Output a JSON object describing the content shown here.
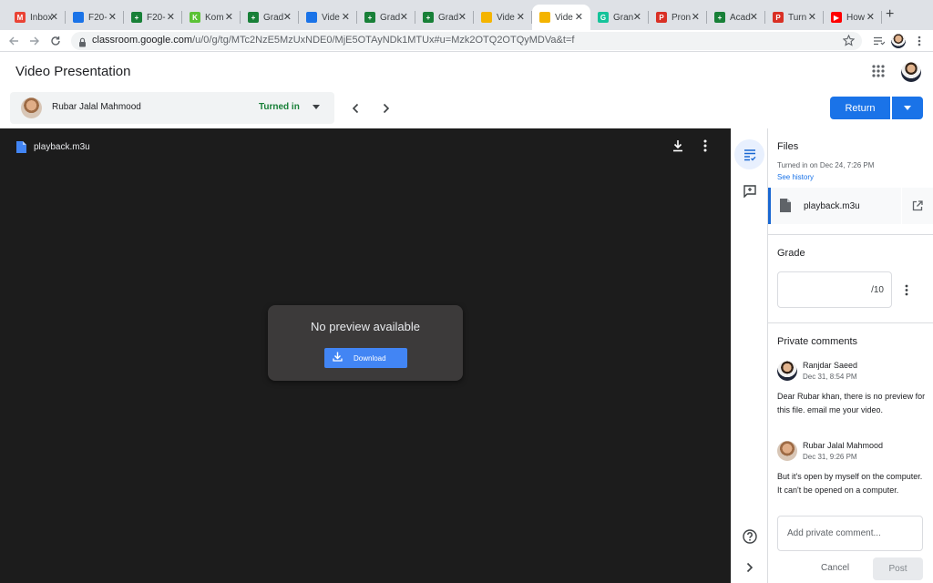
{
  "browser": {
    "tabs": [
      {
        "label": "Inbox",
        "favicon": "gmail-icon",
        "color": "#ea4335",
        "glyph": "M"
      },
      {
        "label": "F20-",
        "favicon": "classroom-icon",
        "color": "#1a73e8",
        "glyph": ""
      },
      {
        "label": "F20-",
        "favicon": "sheets-icon",
        "color": "#188038",
        "glyph": "+"
      },
      {
        "label": "Kom",
        "favicon": "kahoot-icon",
        "color": "#5bc236",
        "glyph": "K"
      },
      {
        "label": "Grad",
        "favicon": "sheets-icon",
        "color": "#188038",
        "glyph": "+"
      },
      {
        "label": "Vide",
        "favicon": "classroom-icon",
        "color": "#1a73e8",
        "glyph": ""
      },
      {
        "label": "Grad",
        "favicon": "sheets-icon",
        "color": "#188038",
        "glyph": "+"
      },
      {
        "label": "Grad",
        "favicon": "sheets-icon",
        "color": "#188038",
        "glyph": "+"
      },
      {
        "label": "Vide",
        "favicon": "slides-icon",
        "color": "#f4b400",
        "glyph": ""
      },
      {
        "label": "Vide",
        "favicon": "classroom-icon",
        "color": "#f4b400",
        "glyph": "",
        "active": true
      },
      {
        "label": "Gran",
        "favicon": "grammarly-icon",
        "color": "#15c39a",
        "glyph": "G"
      },
      {
        "label": "Pron",
        "favicon": "pronunciation-icon",
        "color": "#d93025",
        "glyph": "Ρ"
      },
      {
        "label": "Acad",
        "favicon": "sheets-icon",
        "color": "#188038",
        "glyph": "+"
      },
      {
        "label": "Turn",
        "favicon": "turnitin-icon",
        "color": "#d93025",
        "glyph": "Ρ"
      },
      {
        "label": "How",
        "favicon": "youtube-icon",
        "color": "#ff0000",
        "glyph": "▶"
      }
    ],
    "url_host": "classroom.google.com",
    "url_path": "/u/0/g/tg/MTc2NzE5MzUxNDE0/MjE5OTAyNDk1MTUx#u=Mzk2OTQ2OTQyMDVa&t=f"
  },
  "app": {
    "title": "Video Presentation",
    "student": {
      "name": "Rubar Jalal Mahmood",
      "status": "Turned in"
    },
    "return_label": "Return"
  },
  "viewer": {
    "file_name": "playback.m3u",
    "no_preview": "No preview available",
    "download_label": "Download"
  },
  "panel": {
    "files_title": "Files",
    "turned_in": "Turned in on Dec 24, 7:26 PM",
    "see_history": "See history",
    "attachment": "playback.m3u",
    "grade_title": "Grade",
    "grade_denominator": "/10",
    "comments_title": "Private comments",
    "comments": [
      {
        "author": "Ranjdar Saeed",
        "date": "Dec 31, 8:54 PM",
        "text": "Dear Rubar khan, there is no preview for this file. email me your video."
      },
      {
        "author": "Rubar Jalal Mahmood",
        "date": "Dec 31, 9:26 PM",
        "text": "But it's open by myself on the computer. It can't be opened on a computer."
      }
    ],
    "comment_placeholder": "Add private comment...",
    "cancel_label": "Cancel",
    "post_label": "Post"
  },
  "colors": {
    "accent": "#1a73e8",
    "status_green": "#188038",
    "viewer_bg": "#1c1c1c"
  }
}
